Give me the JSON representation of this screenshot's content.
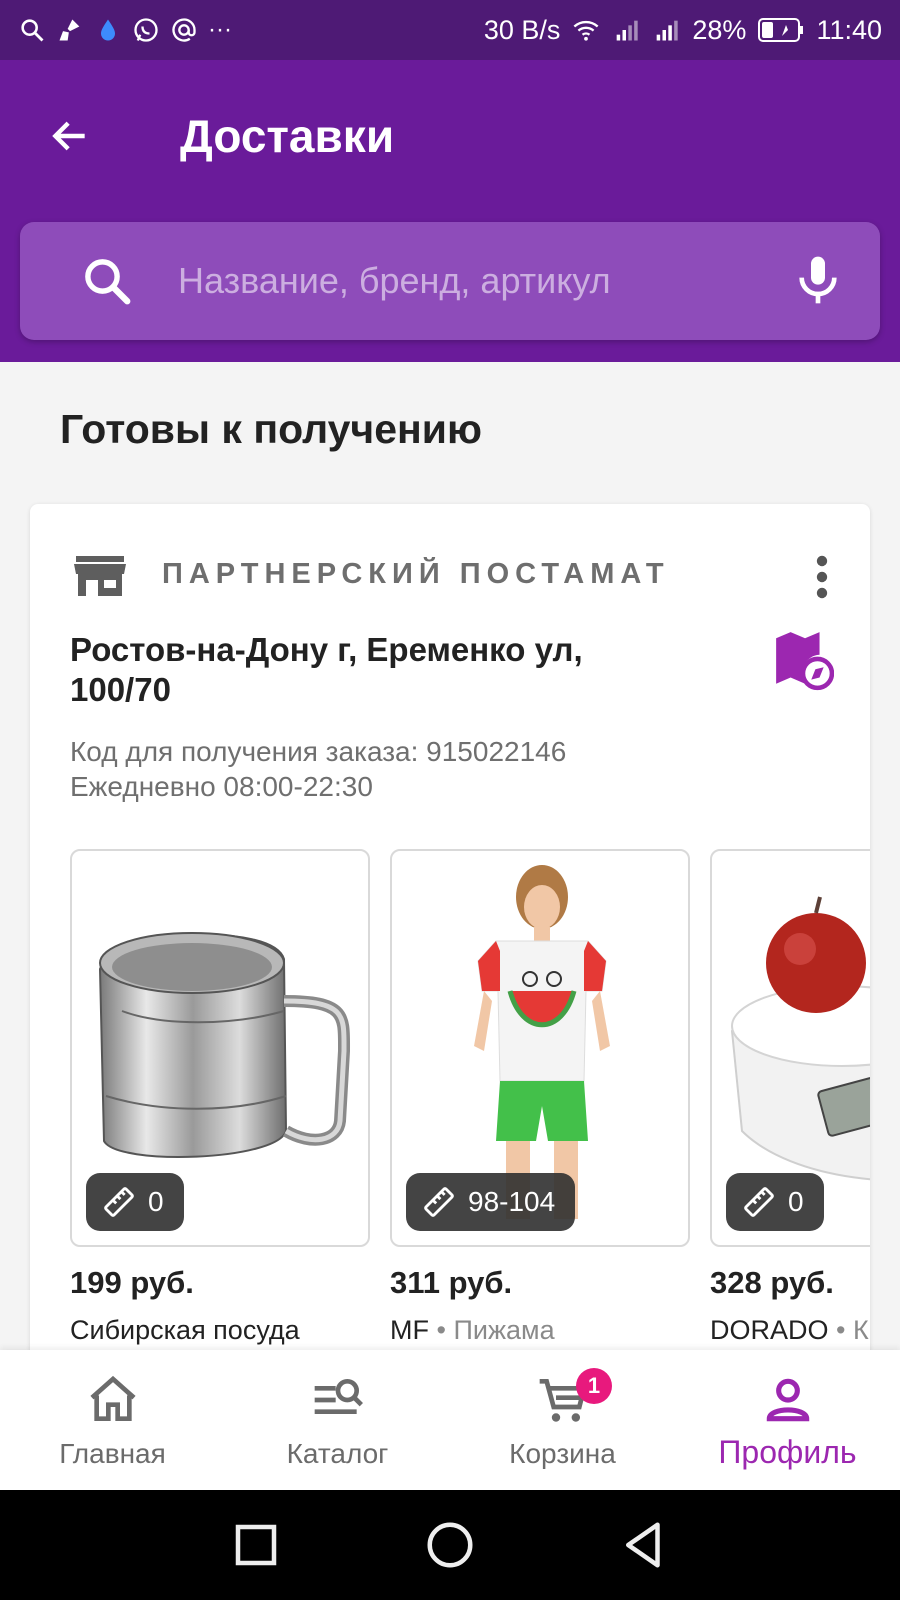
{
  "status_bar": {
    "speed": "30 B/s",
    "battery": "28%",
    "time": "11:40",
    "more": "···"
  },
  "header": {
    "title": "Доставки"
  },
  "search": {
    "placeholder": "Название, бренд, артикул"
  },
  "section": {
    "title": "Готовы к получению"
  },
  "delivery_card": {
    "type_label": "ПАРТНЕРСКИЙ ПОСТАМАТ",
    "address": "Ростов-на-Дону г, Еременко ул, 100/70",
    "pickup_code": "Код для получения заказа: 915022146",
    "schedule": "Ежедневно 08:00-22:30",
    "products": [
      {
        "size": "0",
        "price": "199 руб.",
        "brand": "Сибирская посуда",
        "name": ""
      },
      {
        "size": "98-104",
        "price": "311 руб.",
        "brand": "MF",
        "name": "Пижама"
      },
      {
        "size": "0",
        "price": "328 руб.",
        "brand": "DORADO",
        "name": "К"
      }
    ]
  },
  "bottom_nav": {
    "items": [
      {
        "label": "Главная",
        "icon": "home-icon"
      },
      {
        "label": "Каталог",
        "icon": "catalog-search-icon"
      },
      {
        "label": "Корзина",
        "icon": "cart-icon",
        "badge": "1"
      },
      {
        "label": "Профиль",
        "icon": "profile-icon",
        "active": true
      }
    ]
  },
  "colors": {
    "status_bar": "#4e1a75",
    "app_bar": "#6a1b9a",
    "search_bar": "#8e4cba",
    "accent": "#9c27b0",
    "badge": "#e8197d"
  }
}
